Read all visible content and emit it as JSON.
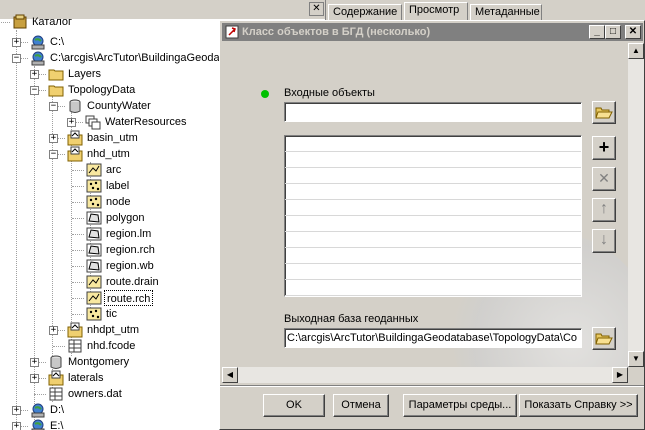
{
  "catalog": {
    "close_glyph": "✕",
    "items": [
      {
        "label": "Каталог",
        "icon": "catalog-icon"
      },
      {
        "label": "C:\\",
        "icon": "drive-icon"
      },
      {
        "label": "C:\\arcgis\\ArcTutor\\BuildingaGeodatabase",
        "icon": "drive-icon"
      },
      {
        "label": "Layers",
        "icon": "folder-icon"
      },
      {
        "label": "TopologyData",
        "icon": "folder-icon"
      },
      {
        "label": "CountyWater",
        "icon": "geodatabase-icon"
      },
      {
        "label": "WaterResources",
        "icon": "feature-dataset-icon"
      },
      {
        "label": "basin_utm",
        "icon": "coverage-icon"
      },
      {
        "label": "nhd_utm",
        "icon": "coverage-icon"
      },
      {
        "label": "arc",
        "icon": "line-class-icon"
      },
      {
        "label": "label",
        "icon": "point-class-icon"
      },
      {
        "label": "node",
        "icon": "point-class-icon"
      },
      {
        "label": "polygon",
        "icon": "polygon-class-icon"
      },
      {
        "label": "region.lm",
        "icon": "polygon-class-icon"
      },
      {
        "label": "region.rch",
        "icon": "polygon-class-icon"
      },
      {
        "label": "region.wb",
        "icon": "polygon-class-icon"
      },
      {
        "label": "route.drain",
        "icon": "line-class-icon"
      },
      {
        "label": "route.rch",
        "icon": "line-class-icon"
      },
      {
        "label": "tic",
        "icon": "point-class-icon"
      },
      {
        "label": "nhdpt_utm",
        "icon": "coverage-icon"
      },
      {
        "label": "nhd.fcode",
        "icon": "table-icon"
      },
      {
        "label": "Montgomery",
        "icon": "geodatabase-icon"
      },
      {
        "label": "laterals",
        "icon": "coverage-icon"
      },
      {
        "label": "owners.dat",
        "icon": "table-icon"
      },
      {
        "label": "D:\\",
        "icon": "drive-icon"
      },
      {
        "label": "E:\\",
        "icon": "drive-icon"
      }
    ]
  },
  "tabs": [
    {
      "label": "Содержание"
    },
    {
      "label": "Просмотр"
    },
    {
      "label": "Метаданные"
    }
  ],
  "dialog": {
    "title": "Класс объектов в БГД (несколько)",
    "input_label": "Входные объекты",
    "input_value": "",
    "output_label": "Выходная база геоданных",
    "output_value": "C:\\arcgis\\ArcTutor\\BuildingaGeodatabase\\TopologyData\\Co",
    "buttons": {
      "ok": "OK",
      "cancel": "Отмена",
      "env": "Параметры среды...",
      "help": "Показать Справку >>"
    },
    "side_buttons": {
      "add": "+",
      "remove": "✕",
      "up": "↑",
      "down": "↓"
    },
    "window_controls": {
      "minimize": "_",
      "maximize": "□",
      "close": "✕"
    },
    "accent_color": "#00c000"
  }
}
